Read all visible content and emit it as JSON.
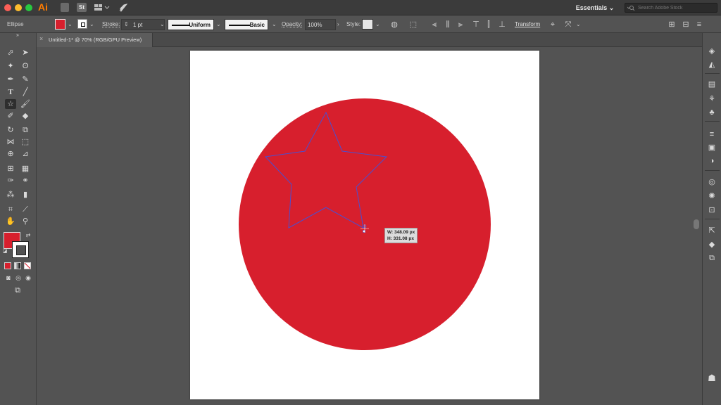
{
  "titlebar": {
    "app_logo": "Ai",
    "bridge_icon": "Br",
    "stock_icon": "St",
    "arrange_icon": "arrange-documents-icon",
    "gpu_icon": "rocket-icon",
    "workspace": "Essentials",
    "search_placeholder": "Search Adobe Stock"
  },
  "controlbar": {
    "selection_type": "Ellipse",
    "fill_color": "#d71f2d",
    "stroke_label": "Stroke:",
    "stroke_weight": "1 pt",
    "profile": "Uniform",
    "brush": "Basic",
    "opacity_label": "Opacity:",
    "opacity_value": "100%",
    "style_label": "Style:",
    "transform_label": "Transform"
  },
  "document": {
    "tab_title": "Untitled-1* @ 70% (RGB/GPU Preview)"
  },
  "canvas": {
    "ellipse_color": "#d71f2d",
    "star_outline_color": "#4a4fd0",
    "tooltip_width": "W: 348.09 px",
    "tooltip_height": "H: 331.08 px"
  },
  "tools": [
    "selection-tool",
    "direct-selection-tool",
    "magic-wand-tool",
    "lasso-tool",
    "pen-tool",
    "curvature-tool",
    "type-tool",
    "line-segment-tool",
    "star-tool",
    "paintbrush-tool",
    "shaper-tool",
    "eraser-tool",
    "rotate-tool",
    "scale-tool",
    "width-tool",
    "free-transform-tool",
    "shape-builder-tool",
    "perspective-grid-tool",
    "mesh-tool",
    "gradient-tool",
    "eyedropper-tool",
    "blend-tool",
    "symbol-sprayer-tool",
    "column-graph-tool",
    "artboard-tool",
    "slice-tool",
    "hand-tool",
    "zoom-tool"
  ]
}
